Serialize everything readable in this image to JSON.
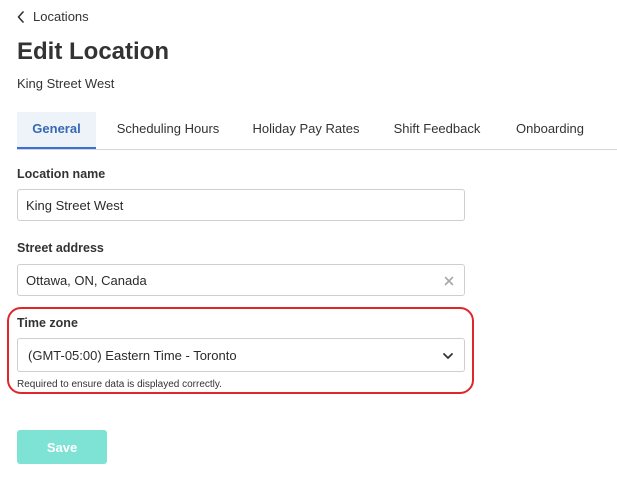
{
  "breadcrumb": {
    "back_label": "Locations"
  },
  "page": {
    "title": "Edit Location",
    "subtitle": "King Street West"
  },
  "tabs": [
    {
      "label": "General",
      "active": true
    },
    {
      "label": "Scheduling Hours",
      "active": false
    },
    {
      "label": "Holiday Pay Rates",
      "active": false
    },
    {
      "label": "Shift Feedback",
      "active": false
    },
    {
      "label": "Onboarding",
      "active": false
    }
  ],
  "form": {
    "location_name": {
      "label": "Location name",
      "value": "King Street West"
    },
    "street_address": {
      "label": "Street address",
      "value": "Ottawa, ON, Canada"
    },
    "time_zone": {
      "label": "Time zone",
      "value": "(GMT-05:00) Eastern Time - Toronto",
      "help": "Required to ensure data is displayed correctly."
    },
    "save_label": "Save"
  },
  "colors": {
    "accent": "#3a6fd8",
    "save_button": "#7ee3d5",
    "highlight": "#e0262c"
  },
  "icons": {
    "back": "chevron-left-icon",
    "clear": "close-icon",
    "select": "chevron-down-icon"
  }
}
